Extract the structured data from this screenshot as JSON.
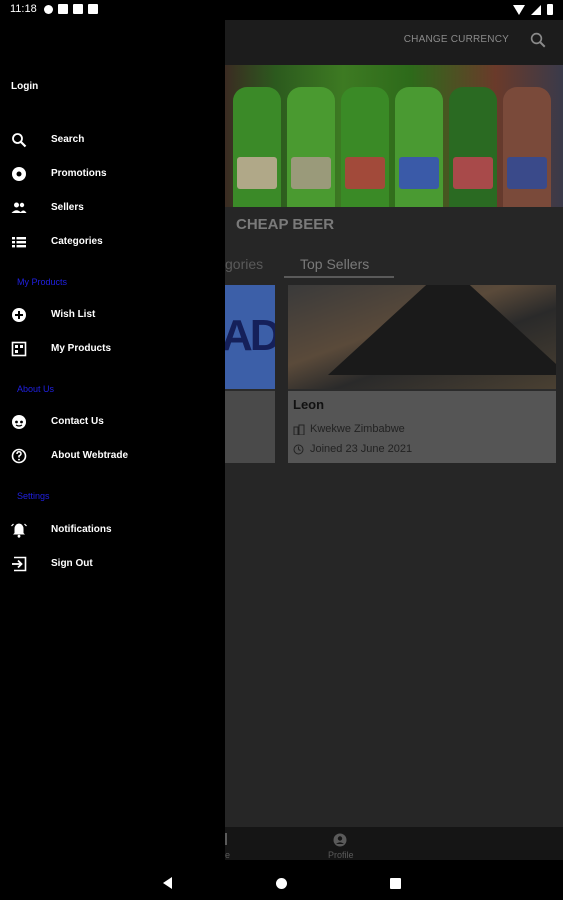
{
  "status": {
    "time": "11:18"
  },
  "topbar": {
    "change_currency": "CHANGE CURRENCY"
  },
  "shop": {
    "title": "CHEAP BEER"
  },
  "tabs": [
    {
      "label": "gories"
    },
    {
      "label": "Top Sellers"
    }
  ],
  "sellers": [
    {
      "name": "Leon",
      "location": "Kwekwe Zimbabwe",
      "joined": "Joined 23 June 2021"
    }
  ],
  "bottom_nav": {
    "home_label": "ne",
    "profile_label": "Profile"
  },
  "drawer": {
    "login": "Login",
    "items": [
      {
        "label": "Search",
        "icon": "search-icon"
      },
      {
        "label": "Promotions",
        "icon": "promotions-icon"
      },
      {
        "label": "Sellers",
        "icon": "sellers-icon"
      },
      {
        "label": "Categories",
        "icon": "categories-icon"
      }
    ],
    "my_products_header": "My Products",
    "my_products_items": [
      {
        "label": "Wish List",
        "icon": "add-circle-icon"
      },
      {
        "label": "My Products",
        "icon": "products-icon"
      }
    ],
    "about_header": "About Us",
    "about_items": [
      {
        "label": "Contact Us",
        "icon": "support-icon"
      },
      {
        "label": "About Webtrade",
        "icon": "help-icon"
      }
    ],
    "settings_header": "Settings",
    "settings_items": [
      {
        "label": "Notifications",
        "icon": "bell-icon"
      },
      {
        "label": "Sign Out",
        "icon": "sign-out-icon"
      }
    ]
  },
  "colors": {
    "drawer_bg": "#000000",
    "section_header": "#2020e0",
    "scrim": "#262626"
  }
}
